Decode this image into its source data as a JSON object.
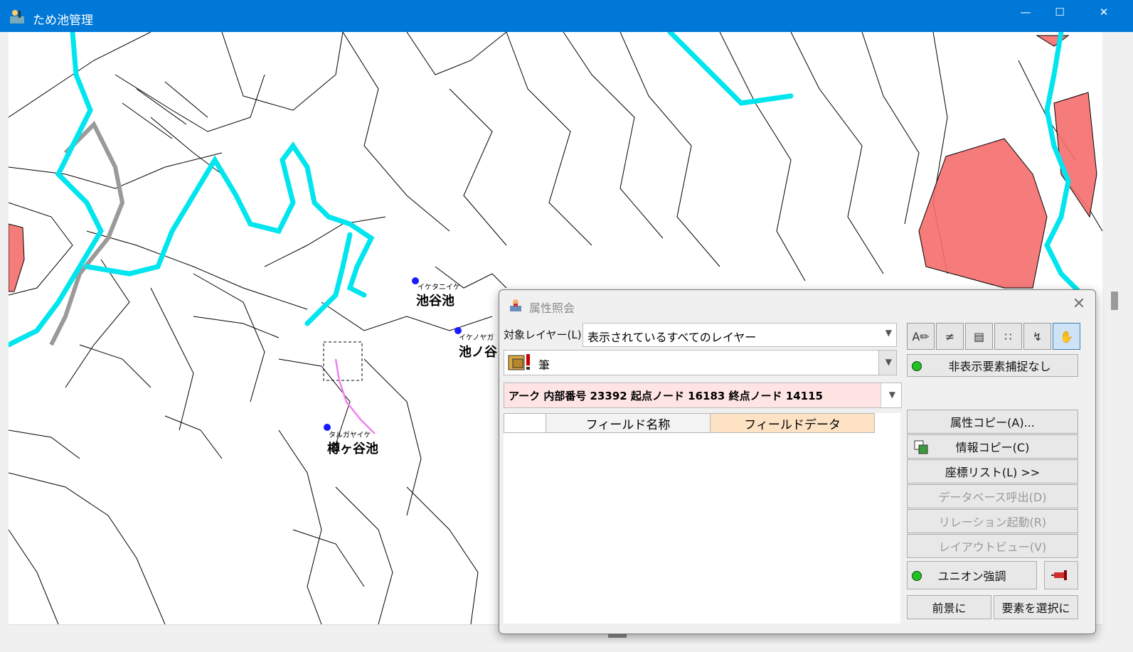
{
  "window": {
    "title": "ため池管理",
    "minimize": "—",
    "maximize": "☐",
    "close": "✕"
  },
  "map": {
    "ponds": [
      {
        "kana": "イケタニイケ",
        "name": "池谷池"
      },
      {
        "kana": "イケノヤガ",
        "name": "池ノ谷"
      },
      {
        "kana": "タルガヤイケ",
        "name": "樽ヶ谷池"
      }
    ],
    "colors": {
      "river": "#00e5ee",
      "highlight": "#f56d6d",
      "selected_arc": "#ee82ee",
      "point": "#0000ff"
    }
  },
  "dialog": {
    "title": "属性照会",
    "close": "✕",
    "layer_label": "対象レイヤー(L)",
    "layer_value": "表示されているすべてのレイヤー",
    "element_value": "筆",
    "arc_info": "アーク 内部番号 23392  起点ノード 16183 終点ノード 14115",
    "table_headers": [
      "",
      "フィールド名称",
      "フィールドデータ"
    ],
    "hidden_capture": "非表示要素捕捉なし",
    "buttons": {
      "attr_copy": "属性コピー(A)...",
      "info_copy": "情報コピー(C)",
      "coord_list": "座標リスト(L) >>",
      "db_call": "データベース呼出(D)",
      "relation": "リレーション起動(R)",
      "layout_view": "レイアウトビュー(V)",
      "union_highlight": "ユニオン強調",
      "foreground": "前景に",
      "select_element": "要素を選択に"
    },
    "tool_icons": [
      "attribute-icon",
      "measure-icon",
      "layout-icon",
      "node-icon",
      "snap-icon",
      "hand-icon"
    ]
  }
}
